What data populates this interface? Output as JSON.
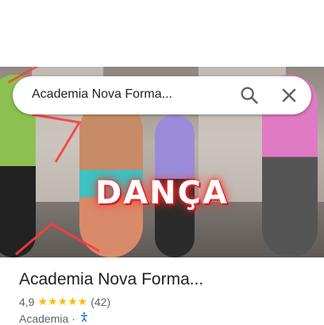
{
  "search": {
    "query": "Academia Nova Forma..."
  },
  "hero": {
    "overlay_title": "DANÇA"
  },
  "place": {
    "name": "Academia Nova Forma...",
    "rating": "4,9",
    "stars": "★★★★★",
    "review_count": "(42)",
    "category": "Academia",
    "separator": "·"
  },
  "colors": {
    "star": "#fbbc04",
    "text_primary": "#202124",
    "text_secondary": "#5f6368",
    "neon_red": "#ff2a2a"
  },
  "icons": [
    "search-icon",
    "close-icon",
    "accessibility-icon"
  ]
}
